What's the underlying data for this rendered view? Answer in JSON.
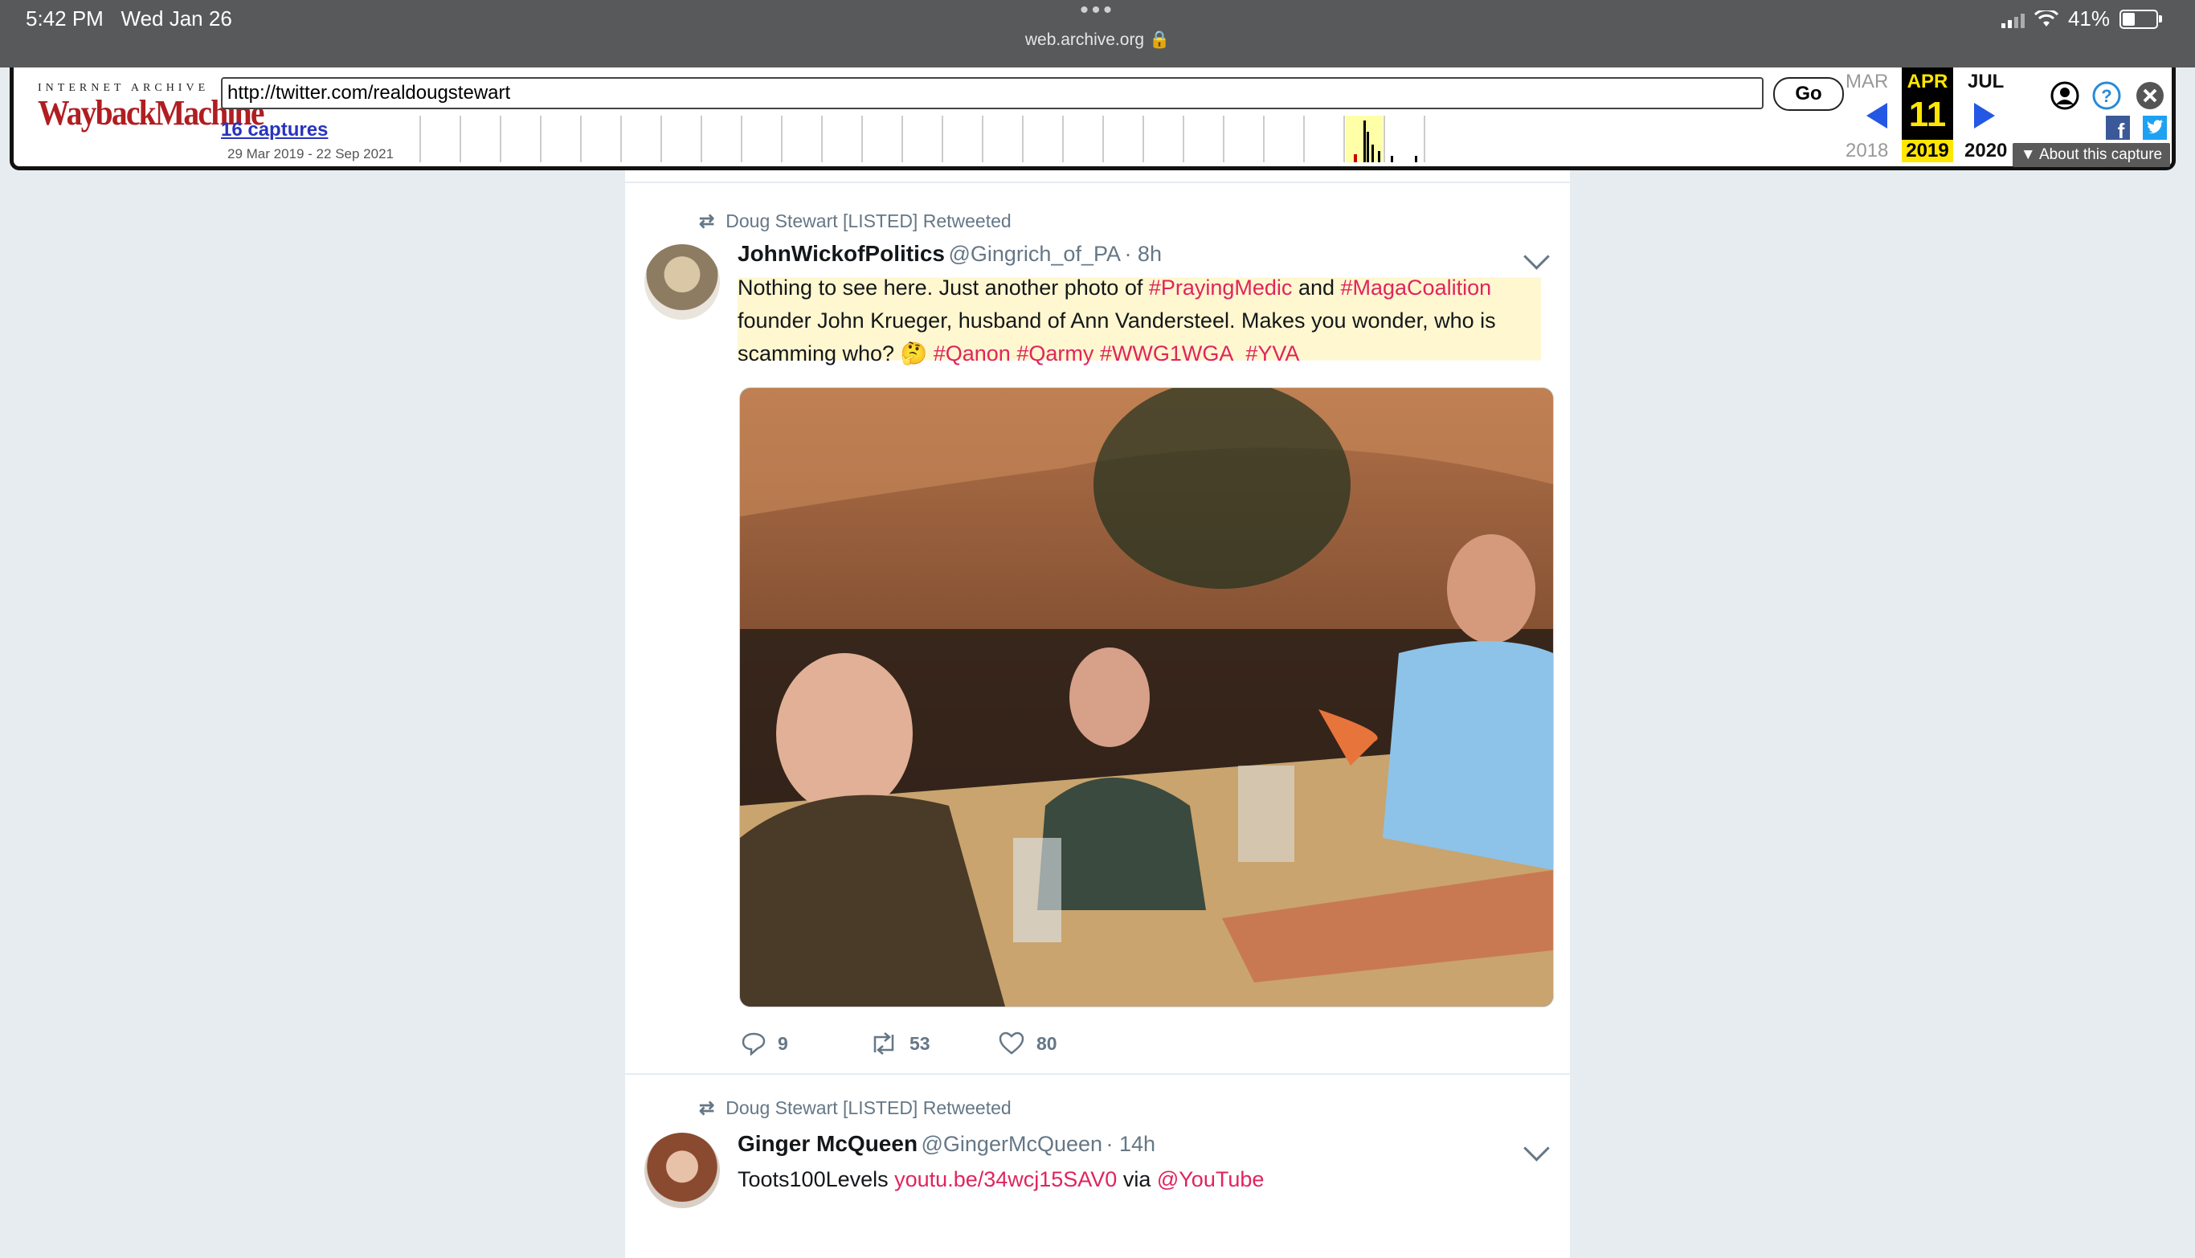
{
  "status_bar": {
    "time": "5:42 PM",
    "date": "Wed Jan 26",
    "url": "web.archive.org",
    "dots": "•••",
    "battery": "41%",
    "battery_level": 0.41
  },
  "wayback": {
    "logo_top": "INTERNET ARCHIVE",
    "logo_main": "WaybackMachine",
    "url_value": "http://twitter.com/realdougstewart",
    "go_label": "Go",
    "captures_link": "16 captures",
    "capture_range": "29 Mar 2019 - 22 Sep 2021",
    "prev_month": "MAR",
    "current_month": "APR",
    "current_day": "11",
    "current_year": "2019",
    "next_month": "JUL",
    "prev_year": "2018",
    "next_year": "2020",
    "about_label": "About this capture",
    "accent": "#ffe600"
  },
  "tweets": [
    {
      "retweet_by": "Doug Stewart [LISTED] Retweeted",
      "name": "JohnWickofPolitics",
      "handle": "@Gingrich_of_PA",
      "time": "· 8h",
      "text_parts": {
        "p1": "Nothing to see here. Just another photo of ",
        "h1": "#PrayingMedic",
        "p2": " and ",
        "h2": "#MagaCoalition",
        "p3": " founder John Krueger, husband of Ann Vandersteel. Makes you wonder, who is scamming who? 🤔 ",
        "h3": "#Qanon",
        "h4": "#Qarmy",
        "h5": "#WWG1WGA",
        "h6": "#YVA"
      },
      "replies": "9",
      "retweets": "53",
      "likes": "80"
    },
    {
      "retweet_by": "Doug Stewart [LISTED] Retweeted",
      "name": "Ginger McQueen",
      "handle": "@GingerMcQueen",
      "time": "· 14h",
      "text": "Toots100Levels ",
      "link": "youtu.be/34wcj15SAV0",
      "via": " via ",
      "mention": "@YouTube"
    }
  ]
}
